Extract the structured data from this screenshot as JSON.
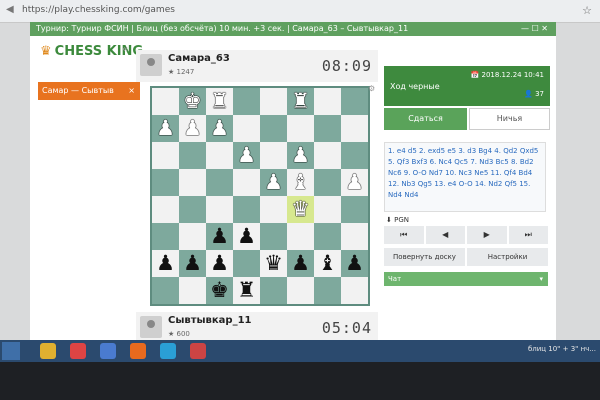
{
  "browser": {
    "url": "https://play.chessking.com/games"
  },
  "window": {
    "title": "Турнир: Турнир ФСИН | Блиц (без обсчёта) 10 мин. +3 сек. | Самара_63 – Сывтывкар_11"
  },
  "app": {
    "logo": "CHESS KING",
    "collapse_icon": "«"
  },
  "sidebar": {
    "active_game_label": "Самар — Сывтыв",
    "close_icon": "×"
  },
  "top_player": {
    "name": "Самара_63",
    "rating": "★ 1247",
    "clock": "08:09"
  },
  "bottom_player": {
    "name": "Сывтывкар_11",
    "rating": "★ 600",
    "clock": "05:04"
  },
  "board": {
    "squares": [
      [
        "",
        "wK",
        "wR",
        "",
        "",
        "wR",
        "",
        ""
      ],
      [
        "wP",
        "wP",
        "wP",
        "",
        "",
        "",
        "",
        ""
      ],
      [
        "",
        "",
        "",
        "wP",
        "",
        "wP",
        "",
        ""
      ],
      [
        "",
        "",
        "",
        "",
        "wP",
        "wB",
        "",
        "wP"
      ],
      [
        "",
        "",
        "",
        "",
        "",
        "wQ",
        "",
        ""
      ],
      [
        "",
        "",
        "bP",
        "bP",
        "",
        "",
        "",
        ""
      ],
      [
        "bP",
        "bP",
        "bP",
        "",
        "bQ",
        "bP",
        "bB",
        "bP"
      ],
      [
        "",
        "",
        "bK",
        "bR",
        "",
        "",
        "",
        ""
      ]
    ],
    "highlight": [
      4,
      5
    ]
  },
  "panel": {
    "datetime": "2018.12.24 10:41",
    "turn_label": "Ход черные",
    "viewers": "37",
    "resign_label": "Сдаться",
    "draw_label": "Ничья",
    "moves": "1. e4 d5 2. exd5 e5 3. d3 Bg4 4. Qd2 Qxd5 5. Qf3 Bxf3 6. Nc4 Qc5 7. Nd3 Bc5 8. Bd2 Nc6 9. O-O Nd7 10. Nc3 Ne5 11. Qf4 Bd4 12. Nb3 Qg5 13. e4 O-O 14. Nd2 Qf5 15. Nd4 Nd4",
    "pgn_label": "PGN",
    "nav": [
      "⏮",
      "◀",
      "▶",
      "⏭"
    ],
    "flip_label": "Повернуть доску",
    "settings_label": "Настройки",
    "chat_label": "Чат"
  },
  "taskbar": {
    "text": "блиц 10\" + 3\" нч..."
  }
}
